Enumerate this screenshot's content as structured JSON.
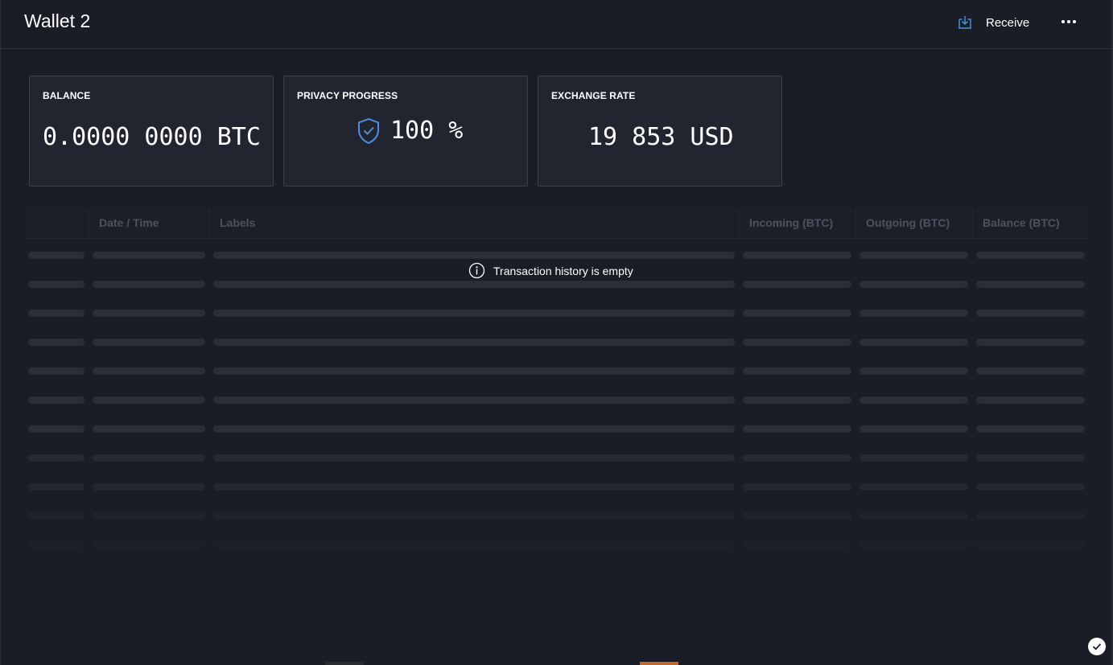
{
  "header": {
    "title": "Wallet 2",
    "receive_label": "Receive",
    "receive_icon": "receive-download-icon",
    "more_icon": "more-horizontal-icon"
  },
  "tiles": {
    "balance": {
      "label": "BALANCE",
      "value": "0.0000 0000 BTC"
    },
    "privacy": {
      "label": "PRIVACY PROGRESS",
      "value": "100 %",
      "progress_percent": 100,
      "icon": "shield-check-icon"
    },
    "exchange": {
      "label": "EXCHANGE RATE",
      "value": "19 853 USD"
    }
  },
  "table": {
    "columns": [
      "",
      "Date / Time",
      "Labels",
      "Incoming (BTC)",
      "Outgoing (BTC)",
      "Balance (BTC)"
    ],
    "empty_message": "Transaction history is empty",
    "empty_icon": "info-icon"
  },
  "colors": {
    "background": "#1a1d26",
    "tile_background": "#22252f",
    "accent_blue": "#4a8fe0",
    "muted_header": "#4d5260",
    "skeleton": "#2b2e37"
  }
}
